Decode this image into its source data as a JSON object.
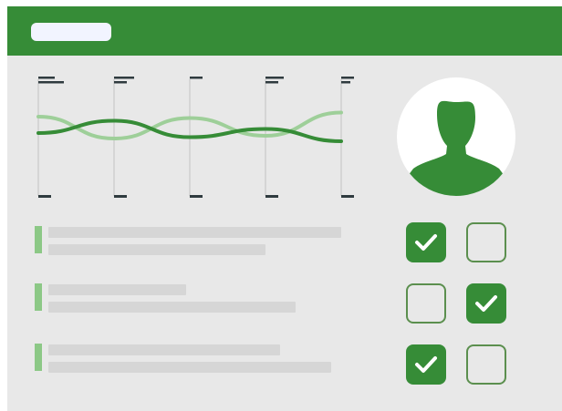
{
  "theme": {
    "accent": "#368c37",
    "accent_light": "#9ecf99",
    "marker": "#8cc886",
    "background": "#e8e8e8",
    "tick": "#2f3b3f",
    "checkbox_border": "#5b8f4e"
  },
  "header": {
    "title_placeholder_icon": "blank-title-bar"
  },
  "chart_data": {
    "type": "line",
    "x": [
      0,
      1,
      2,
      3,
      4
    ],
    "series": [
      {
        "values": [
          0.6,
          -0.2,
          0.55,
          -0.1,
          0.75
        ],
        "color": "#9ecf99"
      },
      {
        "values": [
          0.0,
          0.45,
          -0.15,
          0.15,
          -0.3
        ],
        "color": "#368c37"
      }
    ],
    "grid": true,
    "legend": "none"
  },
  "profile": {
    "avatar_icon": "user-silhouette-icon"
  },
  "list": {
    "rows": [
      {
        "lines": 2
      },
      {
        "lines": 2
      },
      {
        "lines": 2
      }
    ]
  },
  "checkboxes": [
    {
      "checked": true
    },
    {
      "checked": false
    },
    {
      "checked": false
    },
    {
      "checked": true
    },
    {
      "checked": true
    },
    {
      "checked": false
    }
  ]
}
